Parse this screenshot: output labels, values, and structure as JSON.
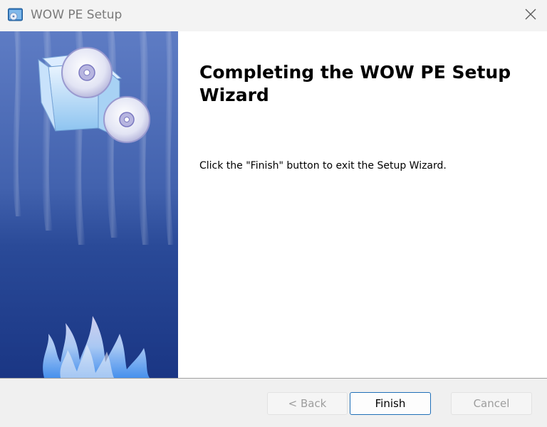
{
  "window": {
    "title": "WOW PE Setup",
    "app_icon": "setup-disc-icon",
    "close_icon": "close-icon"
  },
  "banner": {
    "image": "blue-curtain-with-cd-box-and-flames",
    "colors": {
      "light_blue": "#5a78c0",
      "dark_blue": "#1c3a86",
      "flame_tint": "#9ab8ff"
    }
  },
  "main": {
    "heading": "Completing the WOW PE Setup Wizard",
    "body": "Click the \"Finish\" button to exit the Setup Wizard."
  },
  "footer": {
    "back_label": "< Back",
    "back_enabled": false,
    "finish_label": "Finish",
    "finish_enabled": true,
    "cancel_label": "Cancel",
    "cancel_enabled": false
  },
  "colors": {
    "accent": "#1f6fb8",
    "disabled_text": "#9d9d9d"
  }
}
